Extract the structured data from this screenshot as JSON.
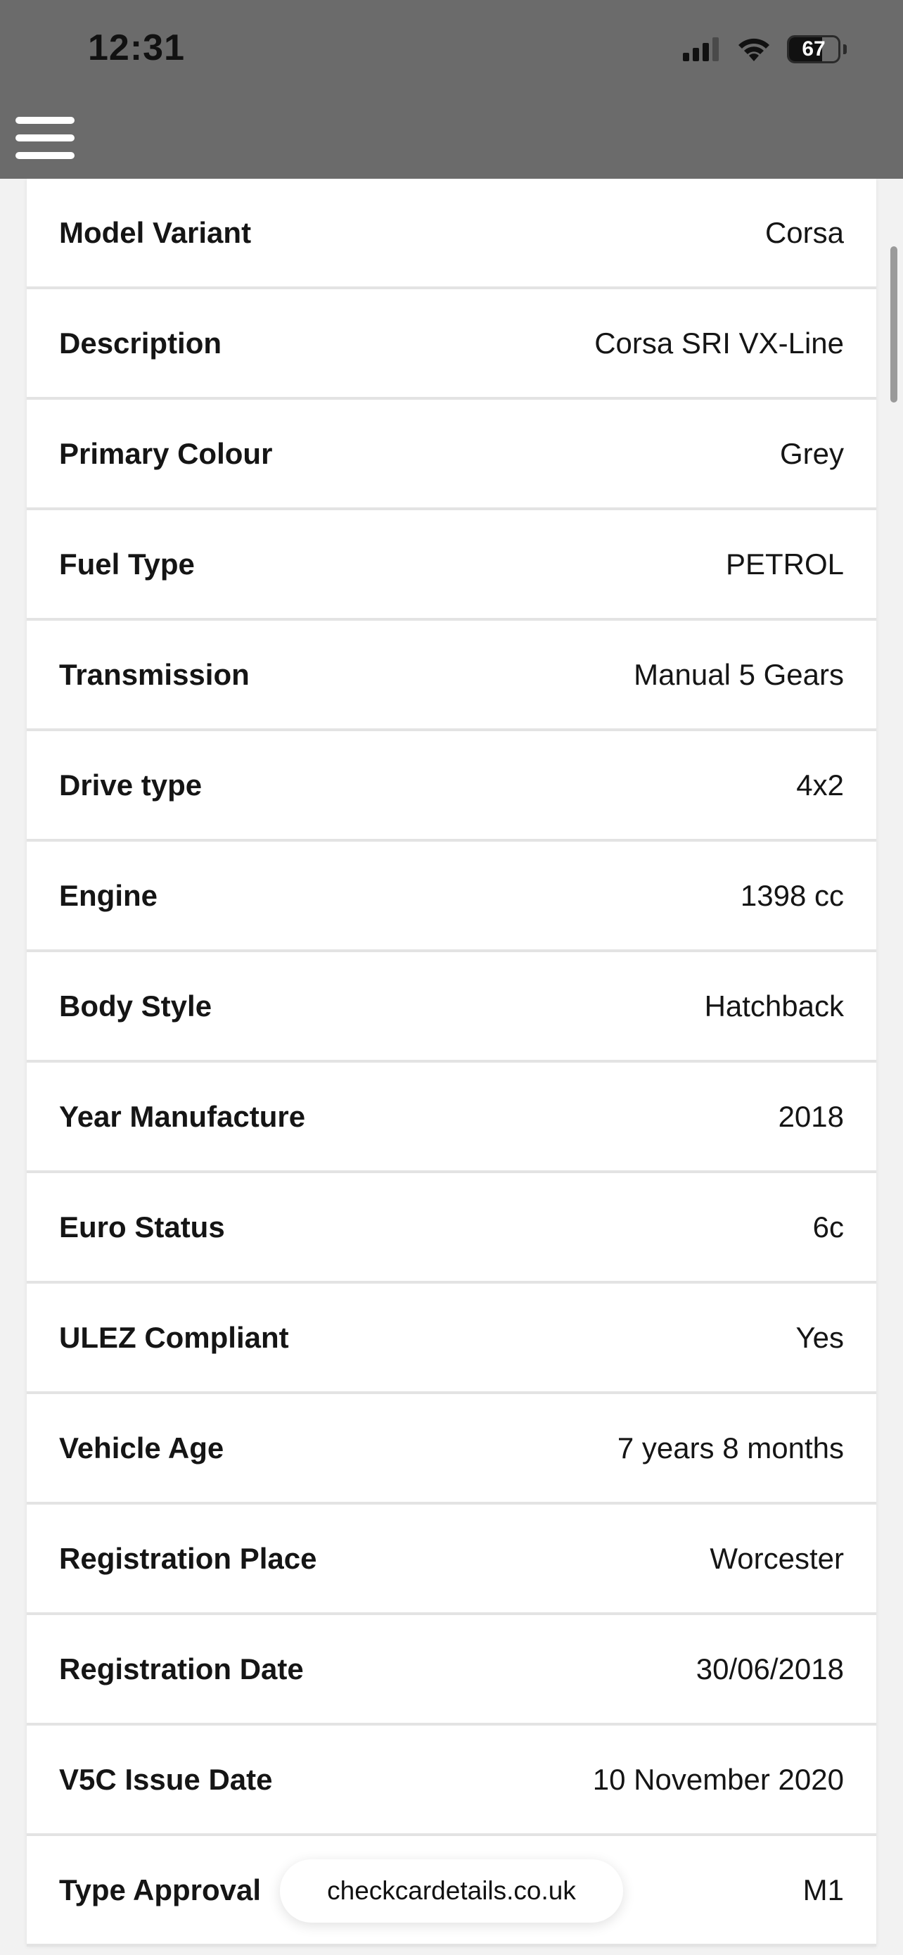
{
  "status_bar": {
    "time": "12:31",
    "battery_level": "67",
    "battery_fraction": 0.67,
    "icons": [
      "signal-icon",
      "wifi-icon",
      "battery-icon"
    ]
  },
  "header": {
    "menu_icon": "hamburger-menu-icon",
    "background_color": "#6b6b6b"
  },
  "vehicle_details": [
    {
      "label": "Model Variant",
      "value": "Corsa"
    },
    {
      "label": "Description",
      "value": "Corsa SRI VX-Line"
    },
    {
      "label": "Primary Colour",
      "value": "Grey"
    },
    {
      "label": "Fuel Type",
      "value": "PETROL"
    },
    {
      "label": "Transmission",
      "value": "Manual 5 Gears"
    },
    {
      "label": "Drive type",
      "value": "4x2"
    },
    {
      "label": "Engine",
      "value": "1398 cc"
    },
    {
      "label": "Body Style",
      "value": "Hatchback"
    },
    {
      "label": "Year Manufacture",
      "value": "2018"
    },
    {
      "label": "Euro Status",
      "value": "6c"
    },
    {
      "label": "ULEZ Compliant",
      "value": "Yes"
    },
    {
      "label": "Vehicle Age",
      "value": "7 years 8 months"
    },
    {
      "label": "Registration Place",
      "value": "Worcester"
    },
    {
      "label": "Registration Date",
      "value": "30/06/2018"
    },
    {
      "label": "V5C Issue Date",
      "value": "10 November 2020"
    },
    {
      "label": "Type Approval",
      "value": "M1"
    }
  ],
  "browser": {
    "url": "checkcardetails.co.uk"
  }
}
